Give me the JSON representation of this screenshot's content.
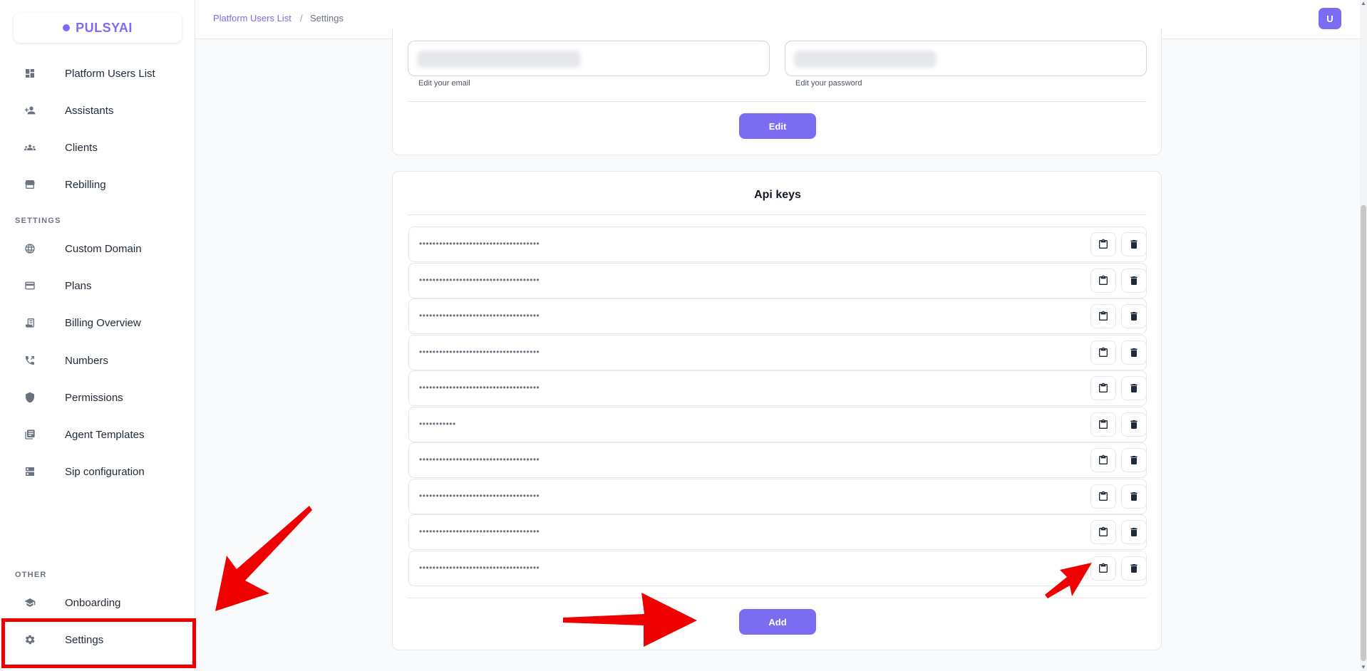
{
  "brand": {
    "name": "PULSYAI",
    "color": "#7c6cf2"
  },
  "sidebar": {
    "main_items": [
      {
        "label": "Platform Users List",
        "icon": "dashboard-icon"
      },
      {
        "label": "Assistants",
        "icon": "person-add-icon"
      },
      {
        "label": "Clients",
        "icon": "group-icon"
      },
      {
        "label": "Rebilling",
        "icon": "store-icon"
      }
    ],
    "settings_section": "SETTINGS",
    "settings_items": [
      {
        "label": "Custom Domain",
        "icon": "globe-icon"
      },
      {
        "label": "Plans",
        "icon": "credit-card-icon"
      },
      {
        "label": "Billing Overview",
        "icon": "receipt-icon"
      },
      {
        "label": "Numbers",
        "icon": "phone-icon"
      },
      {
        "label": "Permissions",
        "icon": "shield-icon"
      },
      {
        "label": "Agent Templates",
        "icon": "library-icon"
      },
      {
        "label": "Sip configuration",
        "icon": "server-icon"
      }
    ],
    "other_section": "OTHER",
    "other_items": [
      {
        "label": "Onboarding",
        "icon": "school-icon"
      },
      {
        "label": "Settings",
        "icon": "gear-icon"
      }
    ]
  },
  "breadcrumb": {
    "parent": "Platform Users List",
    "separator": "/",
    "current": "Settings"
  },
  "user": {
    "avatar_initial": "U"
  },
  "account_card": {
    "email_helper": "Edit your email",
    "password_helper": "Edit your password",
    "edit_label": "Edit"
  },
  "api_keys": {
    "title": "Api keys",
    "keys": [
      "••••••••••••••••••••••••••••••••••••",
      "••••••••••••••••••••••••••••••••••••",
      "••••••••••••••••••••••••••••••••••••",
      "••••••••••••••••••••••••••••••••••••",
      "••••••••••••••••••••••••••••••••••••",
      "•••••••••••",
      "••••••••••••••••••••••••••••••••••••",
      "••••••••••••••••••••••••••••••••••••",
      "••••••••••••••••••••••••••••••••••••",
      "••••••••••••••••••••••••••••••••••••"
    ],
    "copy_icon": "clipboard-icon",
    "delete_icon": "trash-icon",
    "add_label": "Add"
  },
  "annotation_color": "#ef0000"
}
